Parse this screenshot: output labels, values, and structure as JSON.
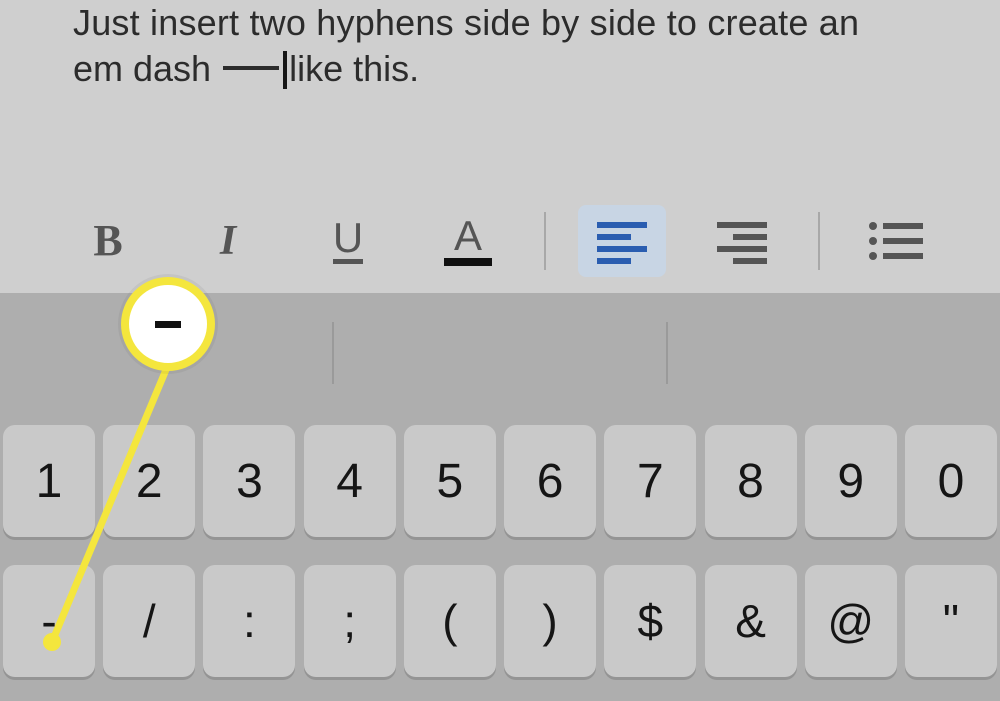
{
  "document": {
    "line1": "Just insert two hyphens side by side to create an",
    "line2_before": "em dash ",
    "line2_after": "like this."
  },
  "toolbar": {
    "bold": "B",
    "italic": "I",
    "underline": "U",
    "textcolor": "A"
  },
  "suggestions": {
    "slot1": "-",
    "slot2": "",
    "slot3": ""
  },
  "keyboard": {
    "row1": [
      "1",
      "2",
      "3",
      "4",
      "5",
      "6",
      "7",
      "8",
      "9",
      "0"
    ],
    "row2": [
      "-",
      "/",
      ":",
      ";",
      "(",
      ")",
      "$",
      "&",
      "@",
      "\""
    ]
  },
  "callout": {
    "glyph": "-"
  }
}
